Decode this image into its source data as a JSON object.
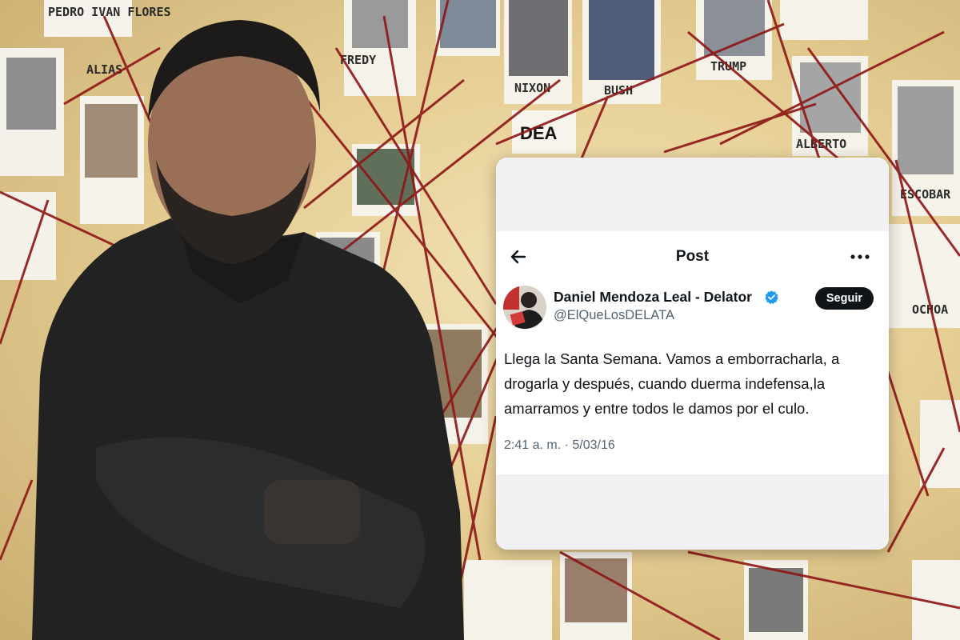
{
  "background": {
    "photo_description": "",
    "card_captions": [
      "PEDRO IVAN FLORES",
      "ALIAS",
      "FREDY",
      "NIXON",
      "BUSH",
      "TRUMP",
      "ALBERTO",
      "DEA",
      "OCHOA",
      "ESCOBAR"
    ]
  },
  "post": {
    "header_title": "Post",
    "back_icon": "arrow-left-icon",
    "more_icon": "more-horizontal-icon",
    "author": {
      "name": "Daniel Mendoza Leal - Delator",
      "handle": "@ElQueLosDELATA",
      "verified_icon": "verified-badge-icon",
      "follow_label": "Seguir"
    },
    "text": "Llega la Santa Semana. Vamos a emborracharla, a drogarla y después, cuando duerma indefensa,la amarramos y entre todos le damos por el culo.",
    "timestamp": "2:41 a. m. · 5/03/16"
  },
  "colors": {
    "verified_blue": "#1d9bf0",
    "text_primary": "#0f1419",
    "text_secondary": "#536471",
    "string_red": "#8e1616"
  }
}
